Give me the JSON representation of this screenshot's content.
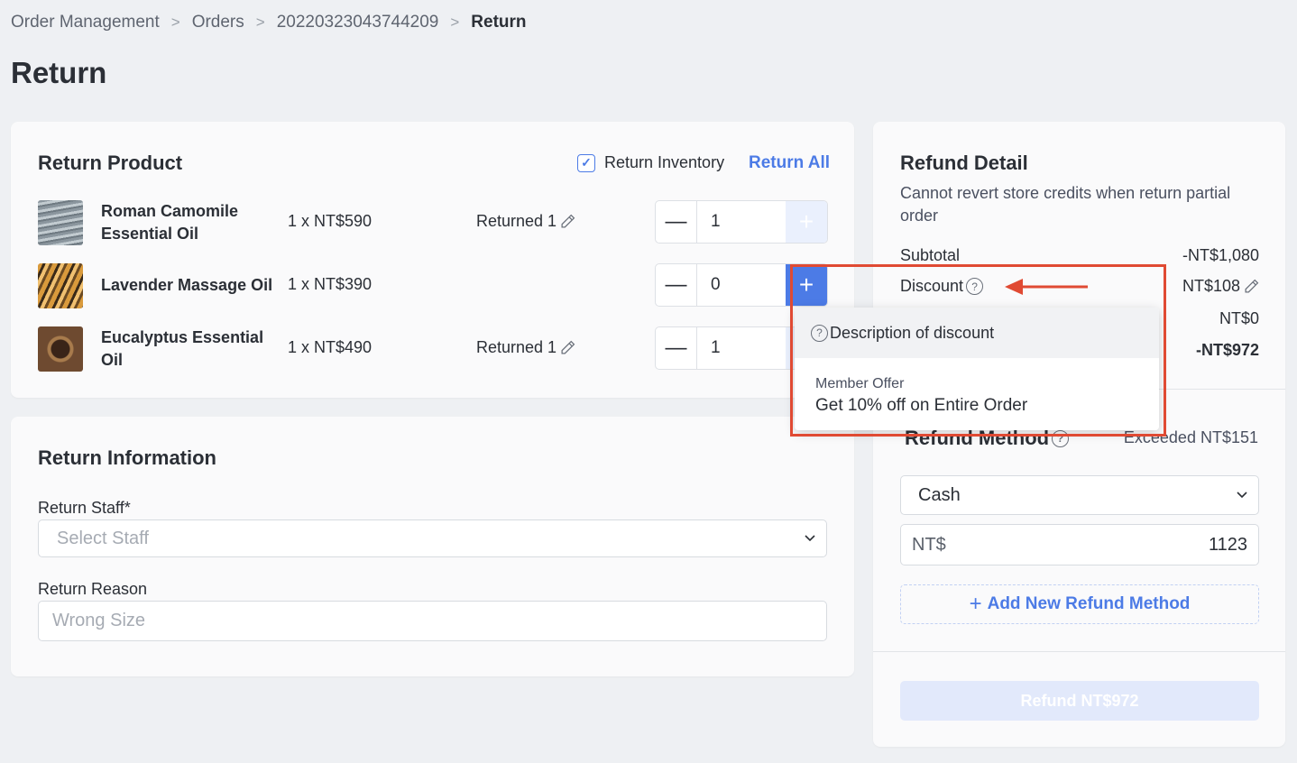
{
  "breadcrumb": [
    "Order Management",
    "Orders",
    "20220323043744209",
    "Return"
  ],
  "page_title": "Return",
  "return_product": {
    "title": "Return Product",
    "return_inventory_label": "Return Inventory",
    "return_inventory_checked": true,
    "return_all_label": "Return All",
    "items": [
      {
        "name_line1": "Roman Camomile",
        "name_line2": "Essential Oil",
        "price": "1 x NT$590",
        "returned": "Returned 1",
        "qty": "1",
        "plus_enabled": false
      },
      {
        "name_line1": "Lavender Massage Oil",
        "name_line2": "",
        "price": "1 x NT$390",
        "returned": "",
        "qty": "0",
        "plus_enabled": true
      },
      {
        "name_line1": "Eucalyptus Essential",
        "name_line2": "Oil",
        "price": "1 x NT$490",
        "returned": "Returned 1",
        "qty": "1",
        "plus_enabled": false
      }
    ]
  },
  "return_info": {
    "title": "Return Information",
    "staff_label": "Return Staff*",
    "staff_placeholder": "Select Staff",
    "reason_label": "Return Reason",
    "reason_placeholder": "Wrong Size"
  },
  "refund_detail": {
    "title": "Refund Detail",
    "subtitle": "Cannot revert store credits when return partial order",
    "subtotal_label": "Subtotal",
    "subtotal_value": "-NT$1,080",
    "discount_label": "Discount",
    "discount_value": "NT$108",
    "row3_value": "NT$0",
    "row4_value": "-NT$972",
    "refund_method_title": "Refund Method",
    "exceeded": "Exceeded NT$151",
    "method_selected": "Cash",
    "currency": "NT$",
    "amount": "1123",
    "add_method_label": "Add New Refund Method",
    "refund_button": "Refund NT$972"
  },
  "popover": {
    "header": "Description of discount",
    "offer_label": "Member Offer",
    "offer_desc": "Get 10% off on Entire Order"
  },
  "colors": {
    "accent": "#4c7be6",
    "highlight": "#e04a33"
  }
}
